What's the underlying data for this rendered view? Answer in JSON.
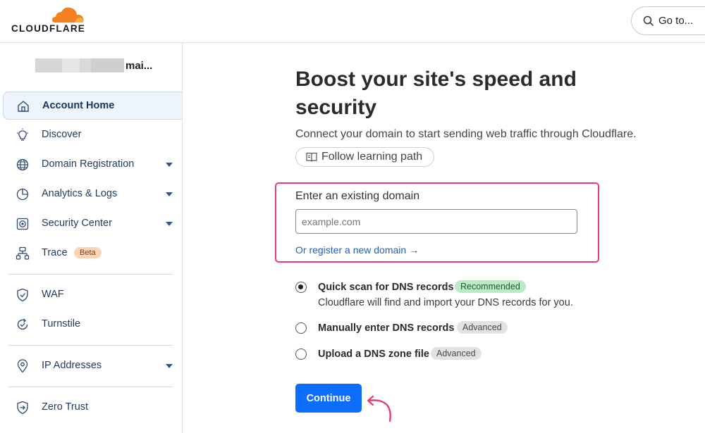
{
  "header": {
    "logo_text": "CLOUDFLARE",
    "goto_label": "Go to...",
    "brand_color": "#f48120"
  },
  "sidebar": {
    "account_name": "mai...",
    "items": [
      {
        "label": "Account Home",
        "icon": "home-icon",
        "active": true,
        "dropdown": false
      },
      {
        "label": "Discover",
        "icon": "lightbulb-icon",
        "active": false,
        "dropdown": false
      },
      {
        "label": "Domain Registration",
        "icon": "globe-icon",
        "active": false,
        "dropdown": true
      },
      {
        "label": "Analytics & Logs",
        "icon": "pie-chart-icon",
        "active": false,
        "dropdown": true
      },
      {
        "label": "Security Center",
        "icon": "security-center-icon",
        "active": false,
        "dropdown": true
      },
      {
        "label": "Trace",
        "icon": "trace-icon",
        "active": false,
        "dropdown": false,
        "badge": "Beta"
      },
      {
        "label": "WAF",
        "icon": "shield-icon",
        "active": false,
        "dropdown": false
      },
      {
        "label": "Turnstile",
        "icon": "turnstile-icon",
        "active": false,
        "dropdown": false
      },
      {
        "label": "IP Addresses",
        "icon": "location-pin-icon",
        "active": false,
        "dropdown": true
      },
      {
        "label": "Zero Trust",
        "icon": "zero-trust-icon",
        "active": false,
        "dropdown": false
      }
    ]
  },
  "main": {
    "title": "Boost your site's speed and security",
    "subtitle": "Connect your domain to start sending web traffic through Cloudflare.",
    "learning_path_label": "Follow learning path",
    "domain_field_label": "Enter an existing domain",
    "domain_placeholder": "example.com",
    "domain_value": "",
    "register_link": "Or register a new domain →",
    "options": [
      {
        "label": "Quick scan for DNS records",
        "badge": "Recommended",
        "description": "Cloudflare will find and import your DNS records for you.",
        "selected": true
      },
      {
        "label": "Manually enter DNS records",
        "badge": "Advanced",
        "selected": false
      },
      {
        "label": "Upload a DNS zone file",
        "badge": "Advanced",
        "selected": false
      }
    ],
    "continue_label": "Continue",
    "highlight_color": "#e83e72",
    "primary_color": "#0d6efd"
  }
}
